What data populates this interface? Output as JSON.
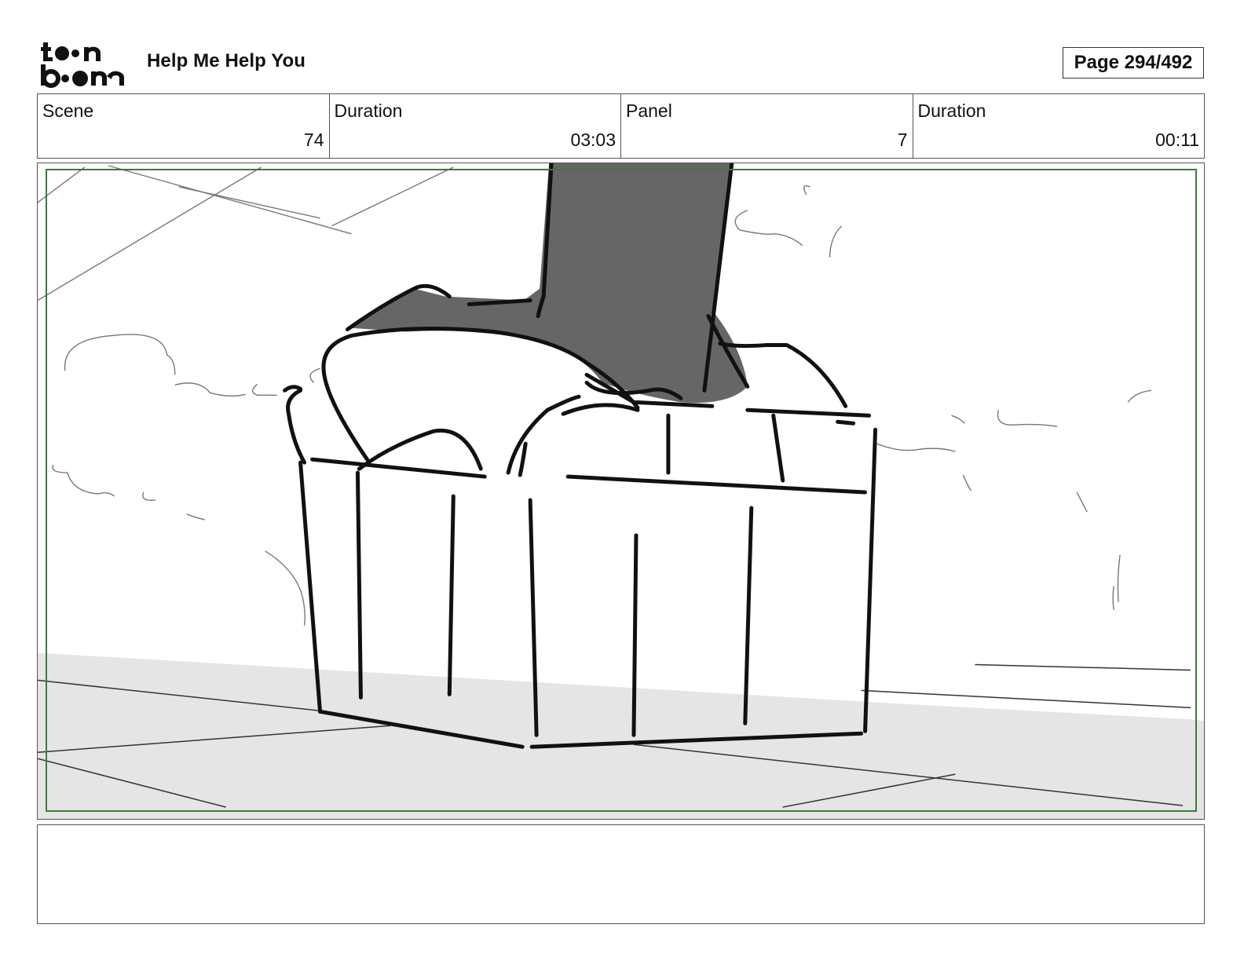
{
  "header": {
    "logo_text": "toon boom",
    "project_title": "Help Me Help You",
    "page_label": "Page 294/492"
  },
  "info": {
    "scene_label": "Scene",
    "scene_value": "74",
    "scene_duration_label": "Duration",
    "scene_duration_value": "03:03",
    "panel_label": "Panel",
    "panel_value": "7",
    "panel_duration_label": "Duration",
    "panel_duration_value": "00:11"
  },
  "panel": {
    "subject": "storyboard-sketch-foot-on-basket",
    "safe_area_color": "#3c7a36",
    "ground_color": "#e5e5e5",
    "leg_color": "#666666"
  },
  "notes": {
    "text": ""
  }
}
